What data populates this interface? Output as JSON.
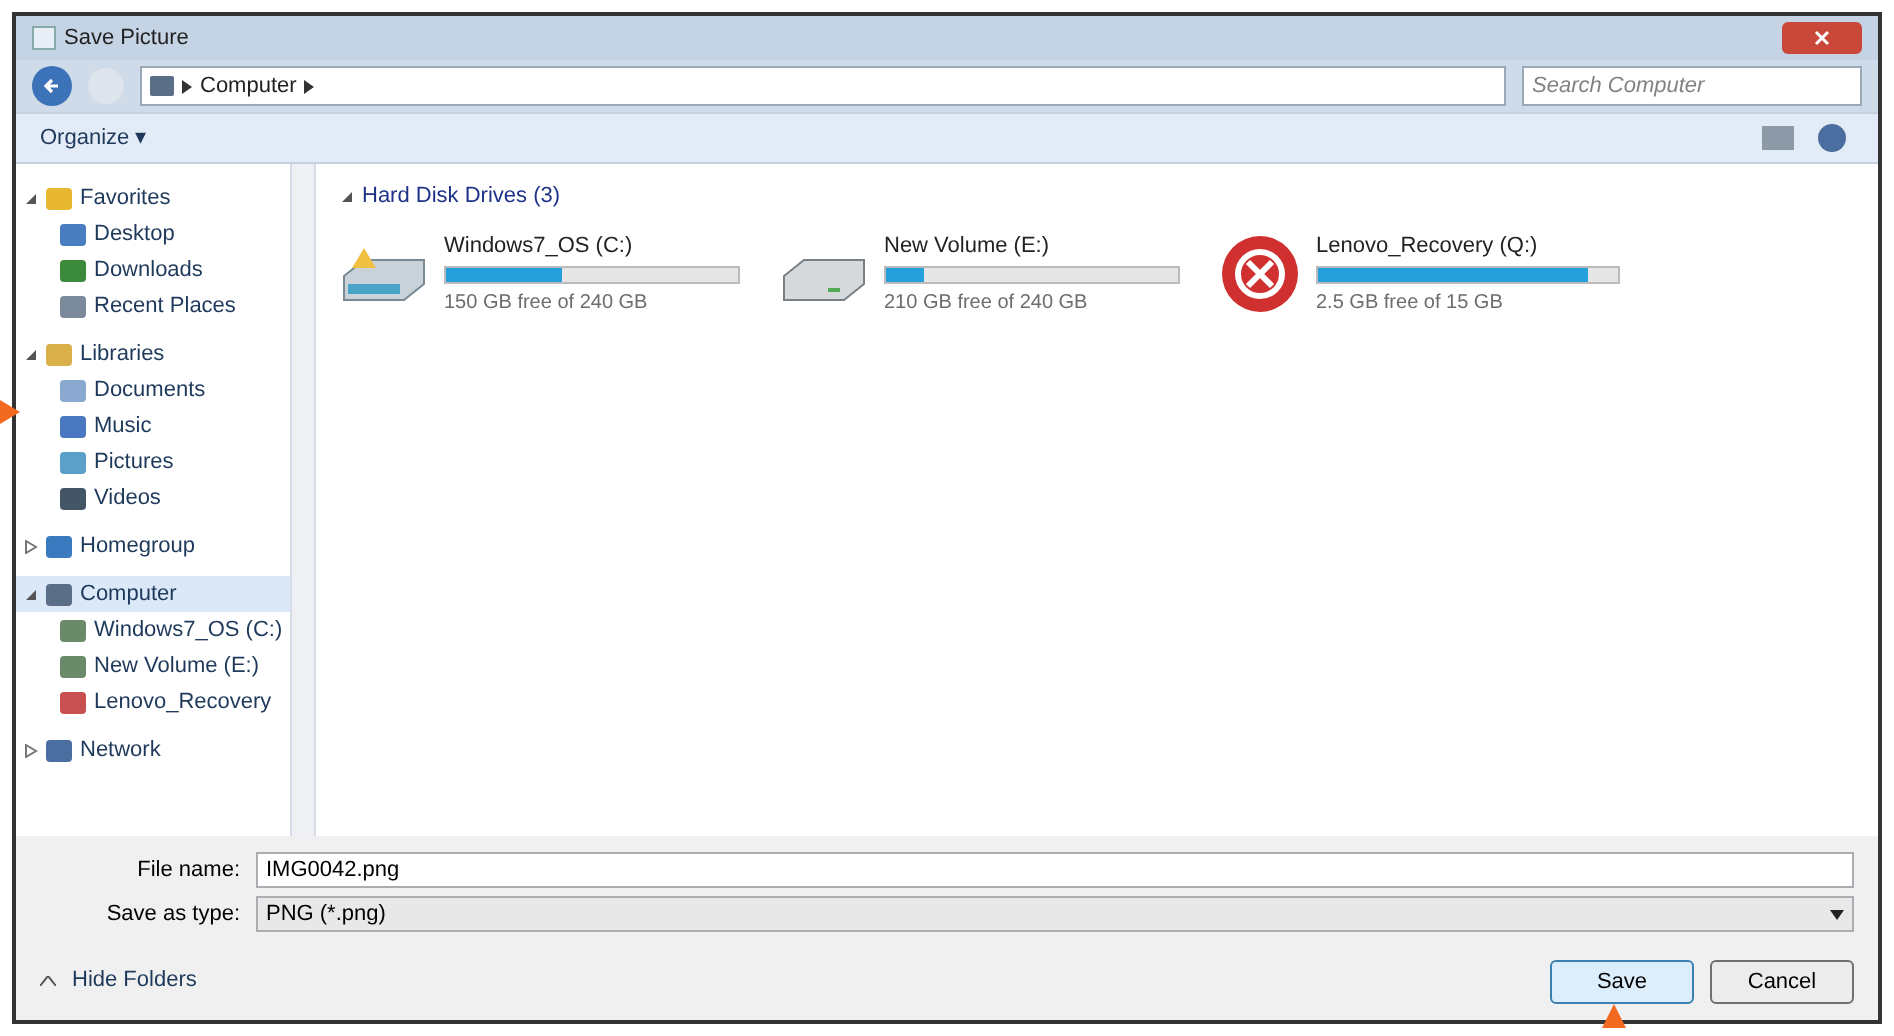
{
  "window": {
    "title": "Save Picture"
  },
  "address_bar": {
    "path": [
      "Computer"
    ],
    "search_placeholder": "Search Computer"
  },
  "toolbar": {
    "organize": "Organize ▾"
  },
  "sidebar": {
    "items": [
      {
        "label": "Favorites",
        "kind": "star",
        "expanded": true,
        "selected": false,
        "children": [
          {
            "label": "Desktop",
            "kind": "desktop",
            "selected": false
          },
          {
            "label": "Downloads",
            "kind": "download",
            "selected": false
          },
          {
            "label": "Recent Places",
            "kind": "recent",
            "selected": false
          }
        ]
      },
      {
        "label": "Libraries",
        "kind": "library",
        "expanded": true,
        "selected": false,
        "children": [
          {
            "label": "Documents",
            "kind": "doc",
            "selected": false
          },
          {
            "label": "Music",
            "kind": "music",
            "selected": false
          },
          {
            "label": "Pictures",
            "kind": "picture",
            "selected": false
          },
          {
            "label": "Videos",
            "kind": "video",
            "selected": false
          }
        ]
      },
      {
        "label": "Homegroup",
        "kind": "homegroup",
        "expanded": false,
        "selected": false
      },
      {
        "label": "Computer",
        "kind": "computer",
        "expanded": true,
        "selected": true,
        "children": [
          {
            "label": "Windows7_OS (C:)",
            "kind": "drive",
            "selected": false
          },
          {
            "label": "New Volume (E:)",
            "kind": "drive",
            "selected": false
          },
          {
            "label": "Lenovo_Recovery",
            "kind": "recovery",
            "selected": false
          }
        ]
      },
      {
        "label": "Network",
        "kind": "network",
        "expanded": false,
        "selected": false
      }
    ]
  },
  "content": {
    "group": "Hard Disk Drives (3)",
    "drives": [
      {
        "name": "Windows7_OS (C:)",
        "kind": "system",
        "level": 0.4,
        "free": "150 GB free of 240 GB"
      },
      {
        "name": "New Volume (E:)",
        "kind": "disk",
        "level": 0.13,
        "free": "210 GB free of 240 GB"
      },
      {
        "name": "Lenovo_Recovery (Q:)",
        "kind": "recovery",
        "level": 0.9,
        "free": "2.5 GB free of 15 GB"
      }
    ]
  },
  "form": {
    "file_name_label": "File name:",
    "file_name": "IMG0042.png",
    "type_label": "Save as type:",
    "type": "PNG (*.png)"
  },
  "footer": {
    "hide_folders": "Hide Folders",
    "buttons": [
      {
        "label": "Save",
        "default": true
      },
      {
        "label": "Cancel",
        "default": false
      }
    ]
  }
}
